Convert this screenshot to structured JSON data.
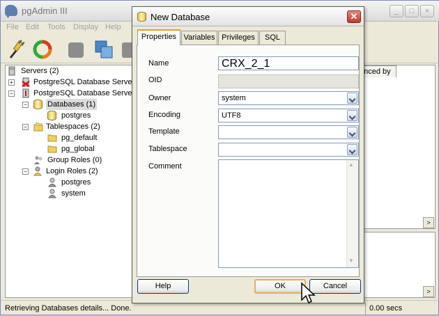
{
  "main_window": {
    "title": "pgAdmin III",
    "menu": [
      "File",
      "Edit",
      "Tools",
      "Display",
      "Help"
    ],
    "status_left": "Retrieving Databases details... Done.",
    "status_right": "0.00 secs",
    "dependencies_tab": "enced by"
  },
  "tree": {
    "servers": "Servers (2)",
    "server1": "PostgreSQL Database Server",
    "server2": "PostgreSQL Database Server",
    "databases": "Databases (1)",
    "db_postgres": "postgres",
    "tablespaces": "Tablespaces (2)",
    "ts_default": "pg_default",
    "ts_global": "pg_global",
    "group_roles": "Group Roles (0)",
    "login_roles": "Login Roles (2)",
    "role_postgres": "postgres",
    "role_system": "system"
  },
  "dialog": {
    "title": "New Database",
    "tabs": [
      "Properties",
      "Variables",
      "Privileges",
      "SQL"
    ],
    "labels": {
      "name": "Name",
      "oid": "OID",
      "owner": "Owner",
      "encoding": "Encoding",
      "template": "Template",
      "tablespace": "Tablespace",
      "comment": "Comment"
    },
    "values": {
      "name": "CRX_2_1",
      "oid": "",
      "owner": "system",
      "encoding": "UTF8",
      "template": "",
      "tablespace": "",
      "comment": ""
    },
    "buttons": {
      "help": "Help",
      "ok": "OK",
      "cancel": "Cancel"
    }
  },
  "colors": {
    "accent_tab": "#e8a020",
    "close_red": "#c0392b",
    "field_border": "#7f9db9"
  }
}
